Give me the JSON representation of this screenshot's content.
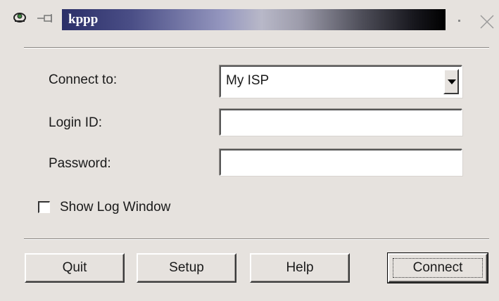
{
  "window": {
    "title": "kppp"
  },
  "form": {
    "connect_to_label": "Connect to:",
    "connect_to_value": "My ISP",
    "login_label": "Login ID:",
    "login_value": "",
    "password_label": "Password:",
    "password_value": ""
  },
  "options": {
    "show_log_label": "Show Log Window",
    "show_log_checked": false
  },
  "buttons": {
    "quit": "Quit",
    "setup": "Setup",
    "help": "Help",
    "connect": "Connect"
  },
  "colors": {
    "background": "#e6e2de",
    "titlebar_start": "#2b2f68",
    "titlebar_end": "#000000"
  }
}
